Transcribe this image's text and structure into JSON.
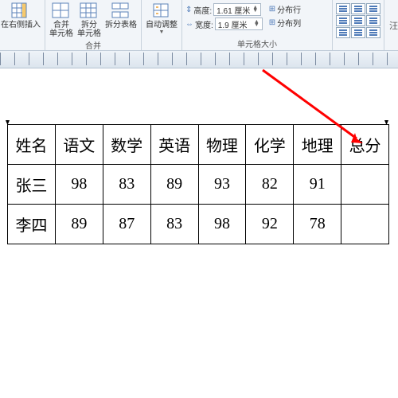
{
  "ribbon": {
    "insert_right": "在右侧插入",
    "merge_group": {
      "merge_cells": "合并\n单元格",
      "split_cells": "拆分\n单元格",
      "split_table": "拆分表格",
      "label": "合并"
    },
    "autofit": "自动调整",
    "size_group": {
      "height_label": "高度:",
      "height_value": "1.61 厘米",
      "width_label": "宽度:",
      "width_value": "1.9 厘米",
      "label": "单元格大小"
    },
    "dist": {
      "rows": "分布行",
      "cols": "分布列"
    },
    "last": "汪"
  },
  "table": {
    "headers": [
      "姓名",
      "语文",
      "数学",
      "英语",
      "物理",
      "化学",
      "地理",
      "总分"
    ],
    "rows": [
      {
        "name": "张三",
        "scores": [
          "98",
          "83",
          "89",
          "93",
          "82",
          "91",
          ""
        ]
      },
      {
        "name": "李四",
        "scores": [
          "89",
          "87",
          "83",
          "98",
          "92",
          "78",
          ""
        ]
      }
    ]
  }
}
